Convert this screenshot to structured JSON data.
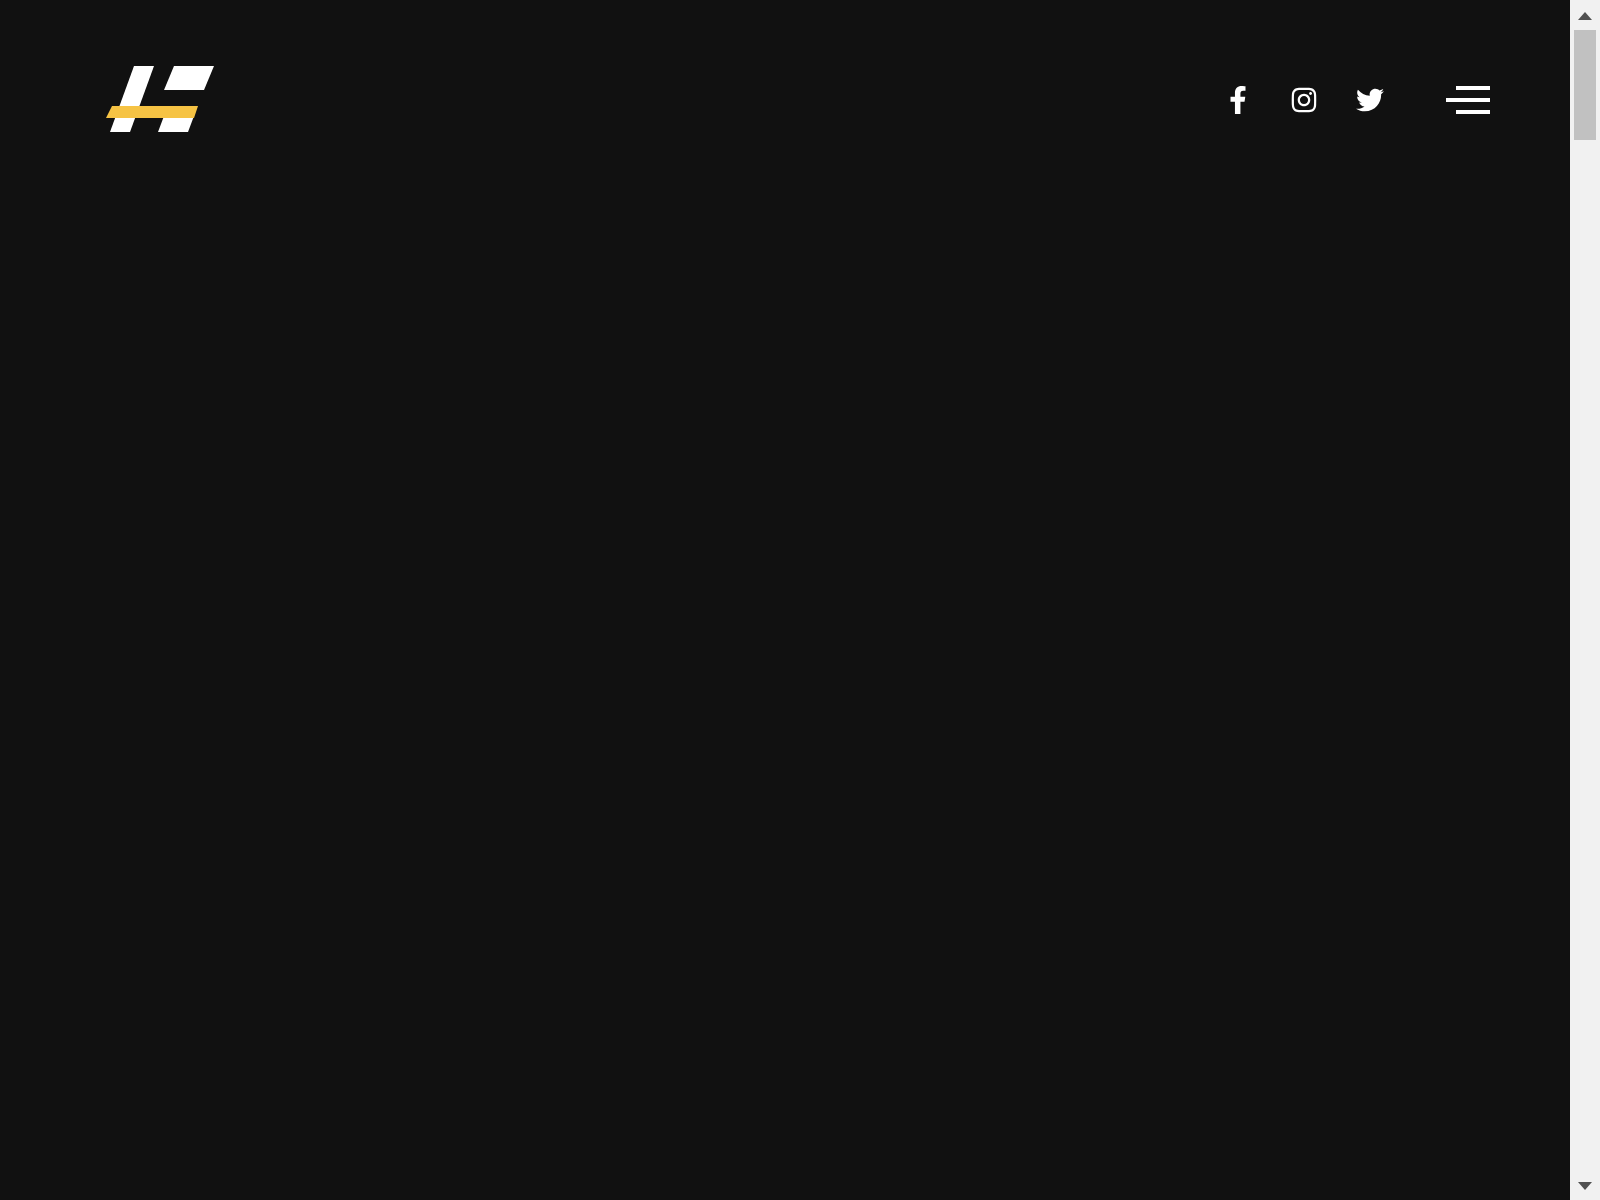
{
  "header": {
    "social_links": [
      {
        "kind": "facebook"
      },
      {
        "kind": "instagram"
      },
      {
        "kind": "twitter"
      }
    ]
  }
}
